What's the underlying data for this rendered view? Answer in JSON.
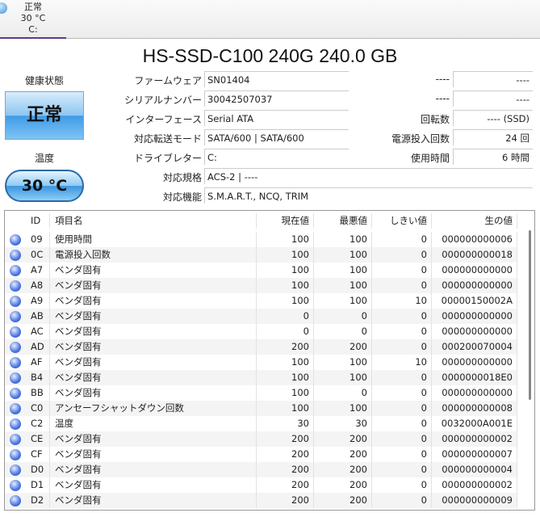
{
  "tab": {
    "status": "正常",
    "temp": "30 °C",
    "drive": "C:"
  },
  "title": "HS-SSD-C100 240G 240.0 GB",
  "left": {
    "health_label": "健康状態",
    "health_value": "正常",
    "temp_label": "温度",
    "temp_value": "30 °C"
  },
  "info": [
    {
      "label": "ファームウェア",
      "value": "SN01404"
    },
    {
      "label": "シリアルナンバー",
      "value": "30042507037"
    },
    {
      "label": "インターフェース",
      "value": "Serial ATA"
    },
    {
      "label": "対応転送モード",
      "value": "SATA/600 | SATA/600"
    },
    {
      "label": "ドライブレター",
      "value": "C:"
    },
    {
      "label": "対応規格",
      "value": "ACS-2 | ----"
    },
    {
      "label": "対応機能",
      "value": "S.M.A.R.T., NCQ, TRIM"
    }
  ],
  "info_right": [
    {
      "label": "----",
      "value": "----"
    },
    {
      "label": "----",
      "value": "----"
    },
    {
      "label": "回転数",
      "value": "---- (SSD)"
    },
    {
      "label": "電源投入回数",
      "value": "24 回"
    },
    {
      "label": "使用時間",
      "value": "6 時間"
    }
  ],
  "smart": {
    "headers": [
      "ID",
      "項目名",
      "現在値",
      "最悪値",
      "しきい値",
      "生の値"
    ],
    "rows": [
      [
        "09",
        "使用時間",
        "100",
        "100",
        "0",
        "000000000006"
      ],
      [
        "0C",
        "電源投入回数",
        "100",
        "100",
        "0",
        "000000000018"
      ],
      [
        "A7",
        "ベンダ固有",
        "100",
        "100",
        "0",
        "000000000000"
      ],
      [
        "A8",
        "ベンダ固有",
        "100",
        "100",
        "0",
        "000000000000"
      ],
      [
        "A9",
        "ベンダ固有",
        "100",
        "100",
        "10",
        "00000150002A"
      ],
      [
        "AB",
        "ベンダ固有",
        "0",
        "0",
        "0",
        "000000000000"
      ],
      [
        "AC",
        "ベンダ固有",
        "0",
        "0",
        "0",
        "000000000000"
      ],
      [
        "AD",
        "ベンダ固有",
        "200",
        "200",
        "0",
        "000200070004"
      ],
      [
        "AF",
        "ベンダ固有",
        "100",
        "100",
        "10",
        "000000000000"
      ],
      [
        "B4",
        "ベンダ固有",
        "100",
        "100",
        "0",
        "0000000018E0"
      ],
      [
        "BB",
        "ベンダ固有",
        "100",
        "0",
        "0",
        "000000000000"
      ],
      [
        "C0",
        "アンセーフシャットダウン回数",
        "100",
        "100",
        "0",
        "000000000008"
      ],
      [
        "C2",
        "温度",
        "30",
        "30",
        "0",
        "0032000A001E"
      ],
      [
        "CE",
        "ベンダ固有",
        "200",
        "200",
        "0",
        "000000000002"
      ],
      [
        "CF",
        "ベンダ固有",
        "200",
        "200",
        "0",
        "000000000007"
      ],
      [
        "D0",
        "ベンダ固有",
        "200",
        "200",
        "0",
        "000000000004"
      ],
      [
        "D1",
        "ベンダ固有",
        "200",
        "200",
        "0",
        "000000000002"
      ],
      [
        "D2",
        "ベンダ固有",
        "200",
        "200",
        "0",
        "000000000009"
      ]
    ]
  }
}
